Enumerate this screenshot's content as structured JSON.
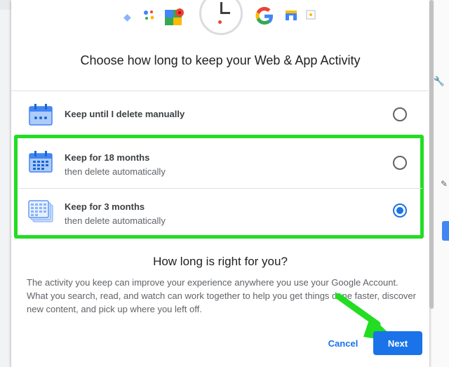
{
  "dialog": {
    "title": "Choose how long to keep your Web & App Activity",
    "options": [
      {
        "main": "Keep until I delete manually",
        "sub": "",
        "selected": false
      },
      {
        "main": "Keep for 18 months",
        "sub": "then delete automatically",
        "selected": false
      },
      {
        "main": "Keep for 3 months",
        "sub": "then delete automatically",
        "selected": true
      }
    ],
    "question": "How long is right for you?",
    "description": "The activity you keep can improve your experience anywhere you use your Google Account. What you search, read, and watch can work together to help you get things done faster, discover new content, and pick up where you left off.",
    "cancel_label": "Cancel",
    "next_label": "Next"
  },
  "hero_icons": [
    "tag-icon",
    "assistant-icon",
    "maps-icon",
    "clock-icon",
    "google-icon",
    "store-icon",
    "photo-icon"
  ],
  "colors": {
    "accent": "#1a73e8",
    "highlight": "#22dd22",
    "arrow": "#22dd22"
  }
}
